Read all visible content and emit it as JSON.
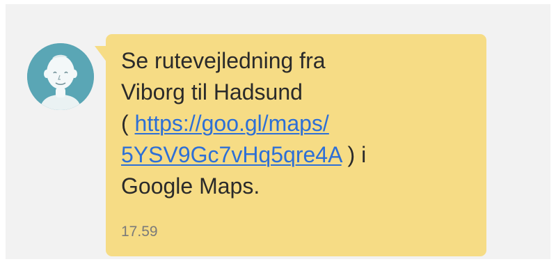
{
  "message": {
    "text_line_1": "Se rutevejledning fra",
    "text_line_2": "Viborg til Hadsund",
    "text_paren_open": "( ",
    "link_part_1": "https://goo.gl/maps/",
    "link_part_2": "5YSV9Gc7vHq5qre4A",
    "text_after_link": " ) i",
    "text_line_5": "Google Maps.",
    "timestamp": "17.59"
  },
  "colors": {
    "bubble": "#f6dc85",
    "avatar": "#5aa6b5",
    "link": "#2d6fd6",
    "background": "#f2f2f2"
  },
  "icons": {
    "avatar": "default-contact-avatar-icon"
  }
}
